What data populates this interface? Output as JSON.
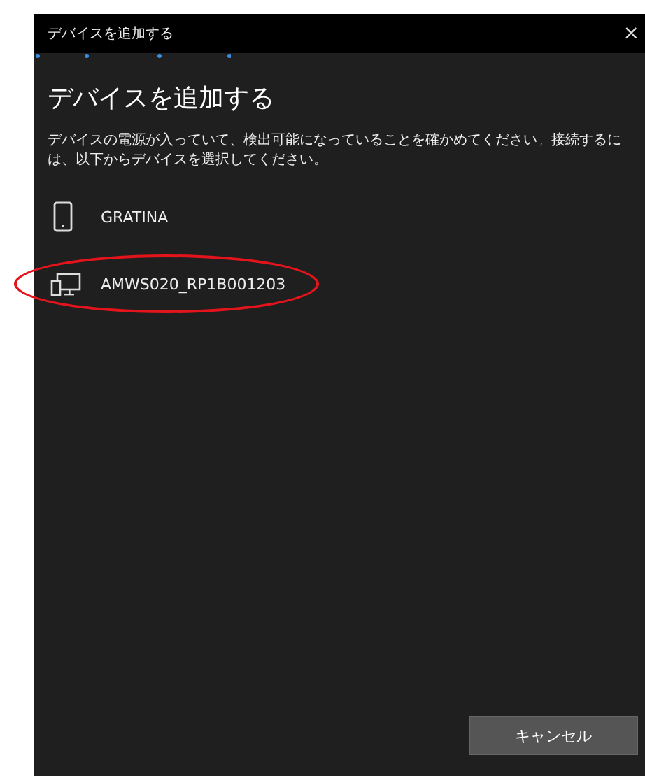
{
  "window": {
    "title": "デバイスを追加する",
    "close": "×"
  },
  "heading": "デバイスを追加する",
  "description": "デバイスの電源が入っていて、検出可能になっていることを確かめてください。接続するには、以下からデバイスを選択してください。",
  "devices": [
    {
      "name": "GRATINA",
      "kind": "phone",
      "highlighted": false
    },
    {
      "name": "AMWS020_RP1B001203",
      "kind": "display",
      "highlighted": true
    }
  ],
  "buttons": [
    {
      "label": "キャンセル"
    }
  ]
}
